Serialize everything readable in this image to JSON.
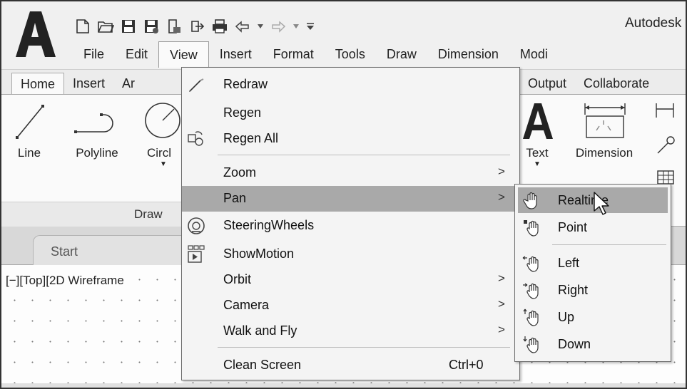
{
  "app": {
    "title": "Autodesk"
  },
  "quick_access": [
    "new-file-icon",
    "open-folder-icon",
    "save-icon",
    "save-as-icon",
    "export-icon",
    "publish-icon",
    "plot-icon",
    "undo-icon",
    "redo-icon",
    "customize-icon"
  ],
  "menubar": [
    "File",
    "Edit",
    "View",
    "Insert",
    "Format",
    "Tools",
    "Draw",
    "Dimension",
    "Modi"
  ],
  "menubar_active": "View",
  "ribbon": {
    "tabs_left": [
      "Home",
      "Insert",
      "Ar"
    ],
    "tabs_right": [
      "Output",
      "Collaborate"
    ],
    "active_tab": "Home",
    "tools": {
      "line": "Line",
      "polyline": "Polyline",
      "circle": "Circl",
      "text": "Text",
      "dimension": "Dimension"
    },
    "panel_title": "Draw"
  },
  "file_tabs": {
    "start": "Start"
  },
  "viewport_label": "[−][Top][2D Wireframe",
  "view_menu": {
    "items": [
      {
        "label": "Redraw",
        "icon": "redraw-icon"
      },
      {
        "label": "Regen"
      },
      {
        "label": "Regen All",
        "icon": "regen-all-icon"
      },
      {
        "label": "Zoom",
        "submenu": ">"
      },
      {
        "label": "Pan",
        "submenu": ">",
        "highlighted": true
      },
      {
        "label": "SteeringWheels",
        "icon": "steeringwheels-icon"
      },
      {
        "label": "ShowMotion",
        "icon": "showmotion-icon"
      },
      {
        "label": "Orbit",
        "submenu": ">"
      },
      {
        "label": "Camera",
        "submenu": ">"
      },
      {
        "label": "Walk and Fly",
        "submenu": ">"
      },
      {
        "label": "Clean Screen",
        "shortcut": "Ctrl+0"
      }
    ]
  },
  "pan_submenu": {
    "items": [
      {
        "label": "Realtime",
        "icon": "pan-hand-icon",
        "highlighted": true
      },
      {
        "label": "Point",
        "icon": "pan-point-icon"
      },
      {
        "label": "Left",
        "icon": "pan-left-icon"
      },
      {
        "label": "Right",
        "icon": "pan-right-icon"
      },
      {
        "label": "Up",
        "icon": "pan-up-icon"
      },
      {
        "label": "Down",
        "icon": "pan-down-icon"
      }
    ]
  }
}
